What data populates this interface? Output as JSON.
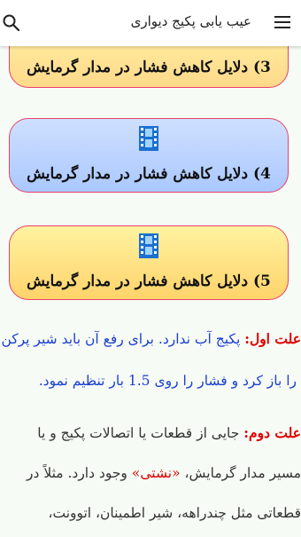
{
  "appbar": {
    "title": "عیب یابی پکیج دیواری",
    "menu_icon": "menu-icon",
    "search_icon": "search-icon"
  },
  "cards": [
    {
      "label": "3) دلایل کاهش فشار در مدار گرمایش"
    },
    {
      "label": "4) دلایل کاهش فشار در مدار گرمایش"
    },
    {
      "label": "5) دلایل کاهش فشار در مدار گرمایش"
    }
  ],
  "body": {
    "cause1_title": "علت اول:",
    "cause1_line1": "پکیج آب ندارد. برای رفع آن باید شیر پرکن",
    "cause1_line2": "را باز کرد و فشار را روی 1.5 بار تنظیم نمود.",
    "cause2_title": "علت دوم:",
    "cause2_line1": "جایی از قطعات یا اتصالات پکیج و یا",
    "cause2_line2a": "مسیر مدار گرمایش،",
    "cause2_line2_quote": "«نشتی»",
    "cause2_line2b": "وجود دارد. مثلاً در",
    "cause2_line3": "قطعاتی مثل چندراهه، شیر اطمینان، اتوونت،"
  },
  "colors": {
    "card_border": "#e8416a",
    "cause_title": "#e00000",
    "cause1_text": "#1a3fd1"
  }
}
